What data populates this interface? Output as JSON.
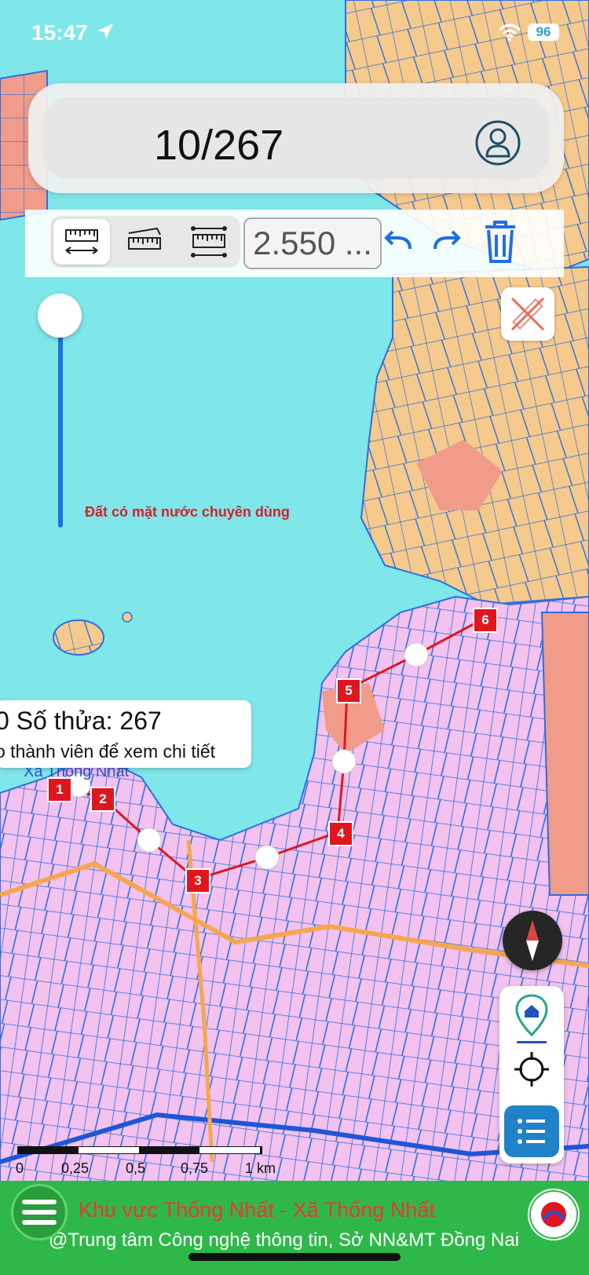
{
  "status_bar": {
    "time": "15:47",
    "battery": "96"
  },
  "search": {
    "count_text": "10/267"
  },
  "measure_toolbar": {
    "value": "2.550 ..."
  },
  "map": {
    "area_label": "Đất có mặt nước chuyên dùng",
    "place_label": "Xã Thống Nhất"
  },
  "route": {
    "points": [
      "1",
      "2",
      "3",
      "4",
      "5",
      "6"
    ]
  },
  "popup": {
    "line1": "0 Số thửa: 267",
    "line2": "o thành viên để xem chi tiết"
  },
  "scale_bar": {
    "labels": [
      "0",
      "0,25",
      "0,5",
      "0,75",
      "1 km"
    ]
  },
  "footer": {
    "title": "Khu vực Thống Nhất - Xã Thống Nhất",
    "subtitle": "@Trung tâm Công nghệ thông tin, Sở NN&MT Đồng Nai"
  },
  "colors": {
    "water": "#7fe6ea",
    "land_pink": "#f3c2ee",
    "land_orange": "#f6c98c",
    "route_red": "#e0161e",
    "footer_green": "#2fb84a",
    "accent_blue": "#1f6fe0"
  },
  "icons": [
    "location-arrow-icon",
    "wifi-icon",
    "user-icon",
    "ruler-distance-icon",
    "ruler-area-icon",
    "ruler-frame-icon",
    "undo-icon",
    "redo-icon",
    "trash-icon",
    "close-measure-icon",
    "compass-icon",
    "home-location-icon",
    "crosshair-icon",
    "list-icon",
    "menu-icon",
    "logo-icon"
  ]
}
